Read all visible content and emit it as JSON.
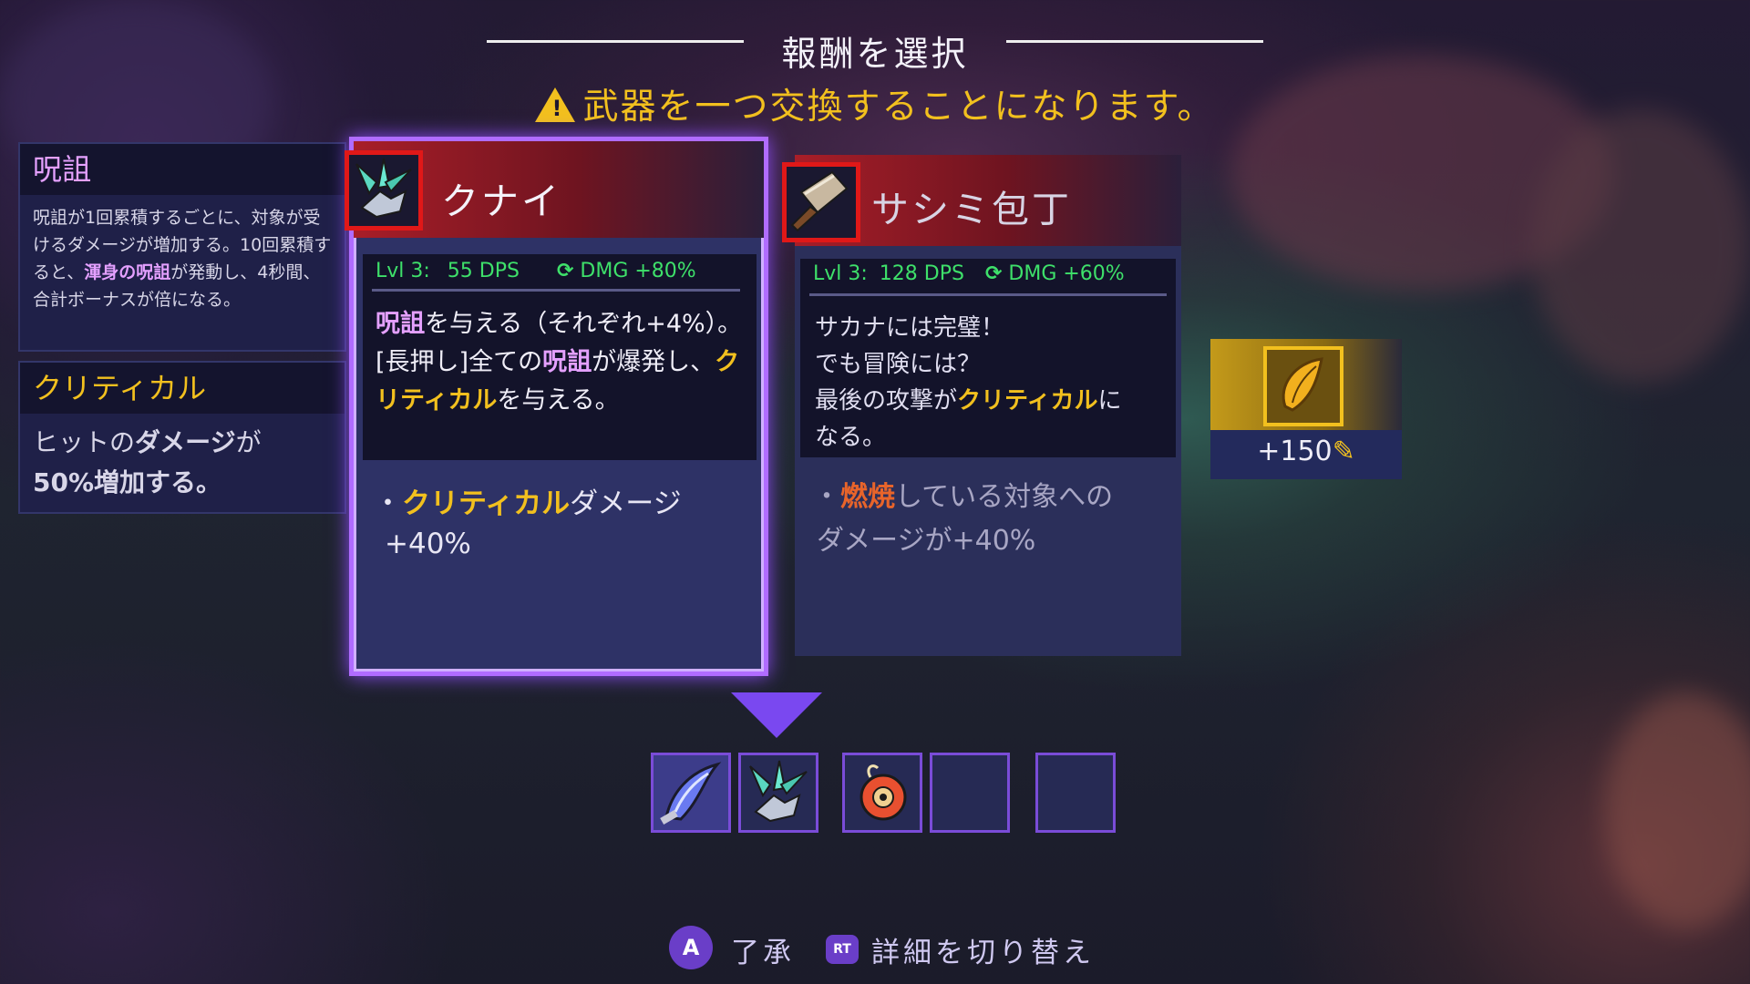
{
  "header": {
    "title": "報酬を選択",
    "warning": "武器を一つ交換することになります。"
  },
  "side_panels": [
    {
      "title": "呪詛",
      "body_parts": [
        "呪詛が1回累積するごとに、対象が受けるダメージが増加する。10回累積すると、",
        "渾身の呪詛",
        "が発動し、4秒間、合計ボーナスが倍になる。"
      ]
    },
    {
      "title": "クリティカル",
      "body_parts": [
        "ヒットの",
        "ダメージ",
        "が",
        "50%増加する。"
      ]
    }
  ],
  "cards": [
    {
      "name": "クナイ",
      "icon": "kunai-icon",
      "level": "Lvl 3:",
      "dps": "55 DPS",
      "dmg": "DMG +80%",
      "desc": {
        "p1": "呪詛",
        "p2": "を与える（それぞれ+4%）。",
        "p3": "[長押し]全ての",
        "p4": "呪詛",
        "p5": "が爆発し、",
        "p6": "クリティカル",
        "p7": "を与える。"
      },
      "bullet": {
        "dot": "・",
        "hl": "クリティカル",
        "rest": "ダメージ",
        "value": "+40%"
      },
      "selected": true
    },
    {
      "name": "サシミ包丁",
      "icon": "cleaver-icon",
      "level": "Lvl 3:",
      "dps": "128 DPS",
      "dmg": "DMG +60%",
      "desc": {
        "l1": "サカナには完璧！",
        "l2": "でも冒険には？",
        "l3a": "最後の攻撃が",
        "l3b": "クリティカル",
        "l3c": "に",
        "l4": "なる。"
      },
      "bullet": {
        "dot": "・",
        "hl": "燃焼",
        "rest": "している対象への",
        "line2": "ダメージが+40%"
      },
      "selected": false
    }
  ],
  "reward": {
    "icon": "golden-shell-icon",
    "amount": "+150"
  },
  "inventory": {
    "slots": [
      "scythe-blade-icon",
      "kunai-icon",
      "bomb-icon",
      "empty-slot",
      "empty-slot"
    ]
  },
  "controls": [
    {
      "key": "A",
      "label": "了承"
    },
    {
      "key": "RT",
      "label": "詳細を切り替え"
    }
  ],
  "colors": {
    "accent_purple": "#8a4cf0",
    "highlight_yellow": "#f2c01e",
    "highlight_purple": "#e4a0ff",
    "stat_green": "#3ee06a",
    "burn_orange": "#e8642a"
  }
}
